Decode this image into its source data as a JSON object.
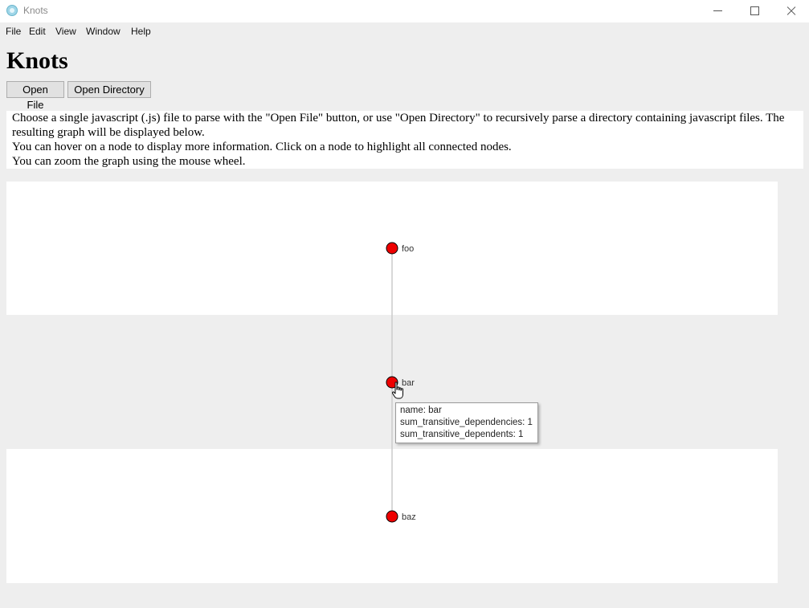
{
  "window": {
    "title": "Knots",
    "icon": "electron-atom-icon"
  },
  "menu": [
    "File",
    "Edit",
    "View",
    "Window",
    "Help"
  ],
  "heading": "Knots",
  "buttons": {
    "open_file": "Open File",
    "open_directory": "Open Directory"
  },
  "instructions": [
    "Choose a single javascript (.js) file to parse with the \"Open File\" button, or use \"Open Directory\" to recursively parse a directory containing javascript files. The resulting graph will be displayed below.",
    "You can hover on a node to display more information. Click on a node to highlight all connected nodes.",
    "You can zoom the graph using the mouse wheel."
  ],
  "graph": {
    "node_color": "#ee0000",
    "edge_color": "#cccccc",
    "nodes": [
      {
        "id": "foo",
        "label": "foo"
      },
      {
        "id": "bar",
        "label": "bar"
      },
      {
        "id": "baz",
        "label": "baz"
      }
    ],
    "edges": [
      {
        "from": "foo",
        "to": "bar"
      },
      {
        "from": "bar",
        "to": "baz"
      }
    ]
  },
  "tooltip": {
    "lines": [
      "name: bar",
      "sum_transitive_dependencies: 1",
      "sum_transitive_dependents: 1"
    ]
  },
  "cursor": "hand-pointer-icon"
}
